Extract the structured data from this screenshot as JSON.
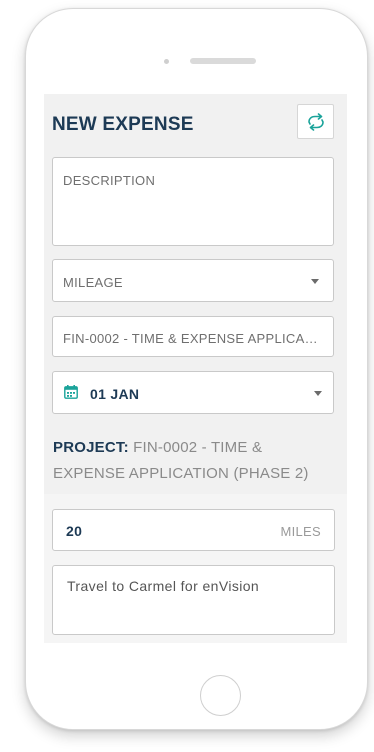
{
  "header": {
    "title": "NEW EXPENSE",
    "sync_icon": "sync-icon"
  },
  "form": {
    "description_placeholder": "DESCRIPTION",
    "type_value": "MILEAGE",
    "project_value": "FIN-0002 - TIME & EXPENSE APPLICA…",
    "date_value": "01 JAN",
    "project_label": "PROJECT:",
    "project_text": "FIN-0002 - TIME & EXPENSE APPLICATION (PHASE 2)",
    "miles_value": "20",
    "miles_unit": "MILES",
    "notes_value": "Travel to Carmel for enVision"
  },
  "colors": {
    "accent": "#1aa39a",
    "title": "#1d3a55"
  }
}
